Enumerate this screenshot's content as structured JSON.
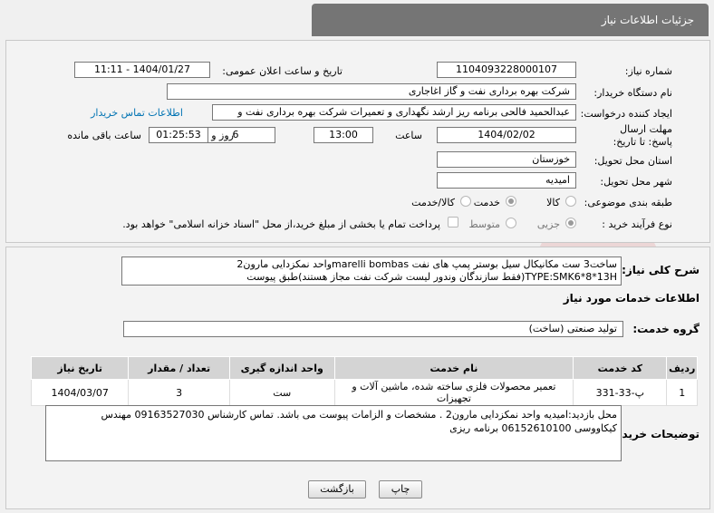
{
  "header": {
    "title": "جزئیات اطلاعات نیاز"
  },
  "need_info": {
    "need_number_label": "شماره نیاز:",
    "need_number": "1104093228000107",
    "announce_label": "تاریخ و ساعت اعلان عمومی:",
    "announce_value": "1404/01/27 - 11:11",
    "buyer_label": "نام دستگاه خریدار:",
    "buyer_value": "شرکت بهره برداری نفت و گاز اغاجاری",
    "creator_label": "ایجاد کننده درخواست:",
    "creator_value": "عبدالحمید فالحی برنامه ریز ارشد نگهداری و تعمیرات شرکت بهره برداری نفت و",
    "contact_link": "اطلاعات تماس خریدار",
    "deadline_label": "مهلت ارسال پاسخ: تا تاریخ:",
    "deadline_date": "1404/02/02",
    "time_label": "ساعت",
    "deadline_time": "13:00",
    "days_value": "6",
    "days_label": "روز و",
    "remaining_time": "01:25:53",
    "remaining_label": "ساعت باقی مانده",
    "province_label": "استان محل تحویل:",
    "province_value": "خوزستان",
    "city_label": "شهر محل تحویل:",
    "city_value": "امیدیه",
    "category_label": "طبقه بندی موضوعی:",
    "category_options": [
      "کالا",
      "خدمت",
      "کالا/خدمت"
    ],
    "category_selected": "خدمت",
    "process_label": "نوع فرآیند خرید :",
    "process_options": [
      "جزیی",
      "متوسط"
    ],
    "process_selected": "جزیی",
    "payment_note": "پرداخت تمام یا بخشی از مبلغ خرید،از محل \"اسناد خزانه اسلامی\" خواهد بود."
  },
  "description": {
    "label": "شرح کلی نیاز:",
    "line1": "ساخت3 ست مکانیکال سیل بوستر پمپ های نفت marelli bombasواحد نمکزدایی مارون2",
    "line2": "TYPE:SMK6*8*13H(فقط سازندگان وندور لیست شرکت نفت مجاز هستند)طبق پیوست"
  },
  "services": {
    "section_title": "اطلاعات خدمات مورد نیاز",
    "group_label": "گروه خدمت:",
    "group_value": "تولید صنعتی (ساخت)",
    "columns": [
      "ردیف",
      "کد خدمت",
      "نام خدمت",
      "واحد اندازه گیری",
      "تعداد / مقدار",
      "تاریخ نیاز"
    ],
    "rows": [
      [
        "1",
        "پ-33-331",
        "تعمیر محصولات فلزی ساخته شده، ماشین آلات و تجهیزات",
        "ست",
        "3",
        "1404/03/07"
      ]
    ]
  },
  "buyer_notes": {
    "label": "توضیحات خریدار:",
    "line1": "محل بازدید:امیدیه واحد نمکزدایی مارون2 . مشخصات و الزامات پیوست می باشد. تماس کارشناس 09163527030 مهندس",
    "line2": "کیکاووسی 06152610100 برنامه ریزی"
  },
  "buttons": {
    "print": "چاپ",
    "back": "بازگشت"
  }
}
